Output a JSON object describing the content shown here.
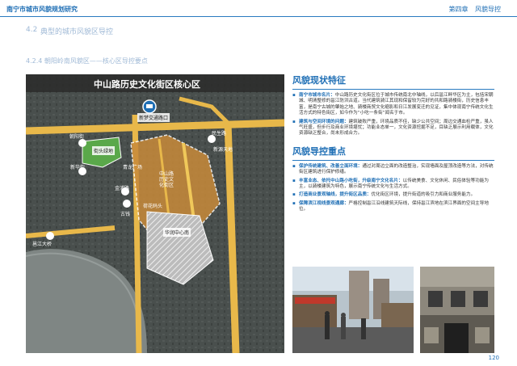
{
  "header": {
    "left": "南宁市城市风貌规划研究",
    "right_chapter": "第四章",
    "right_section": "风貌导控"
  },
  "section": {
    "number": "4.2",
    "title": "典型的城市风貌区导控"
  },
  "subsection": {
    "title": "4.2.4 朝阳岭南风貌区——核心区导控要点"
  },
  "map": {
    "title": "中山路历史文化街区核心区",
    "labels": {
      "traffic_hub": "新梦交通路口",
      "park": "街头绿地",
      "chaoyang_street": "朝阳街",
      "minsheng_road": "民生路",
      "xinhua_street": "新华街",
      "qinglong_square": "青龙广场",
      "zhongshan_road": "中山路历史文化街区",
      "jinpu_road": "金浦路",
      "gujing": "古钱",
      "hehua_ferry": "荷花码头",
      "zhongshan_road_south": "中山路",
      "yongjiang_bridge": "邕江大桥",
      "xinyuan_tiandi": "新源天地",
      "huaxia_plaza": "华润中心南",
      "baiyun_pavilion": "岜蒙江亭"
    }
  },
  "features": {
    "heading": "风貌现状特征",
    "items": [
      {
        "label": "南宁市城市名片：",
        "text": "中山路历史文化街区位于城市传统南北中轴线，以后邕江畔华区为主，包括宋朝城、明清整修的邕江防洪古道。当代建筑骑江其现和保留较为完好的共和路骑楼街，历史信息丰富，是南宁古城的肇始之地、骑楼商贸文化缩影和日江发展变迁的见证，集中体现南宁传统文化生活方式的特色街区，如今作为“小吃一条街”闻名于市。"
      },
      {
        "label": "建筑与空间环境的问题：",
        "text": "建筑破败严重，环境品质不佳，缺少公共空间；周边交通血检严重，虽人气旺盛，但步行及商业环境堪忧；功能业态单一，文化资源挖掘不足，目缺乏展示利用载体，文化资源缺乏整合，尚未形成合力。"
      }
    ]
  },
  "guidance": {
    "heading": "风貌导控重点",
    "items": [
      {
        "label": "保护传统建筑、改善立面环境：",
        "text": "通过对周边立面的改造整治，实现墙面及屋顶改造等方法，对传统街区建筑进行保护修缮。"
      },
      {
        "label": "丰富业态、依托中山路小吃街，升级南宁文化名片：",
        "text": "以传统美食、文化休闲、民俗体验等功能为主，以骑楼建筑为特色，展示南宁传统文化与生活方式。"
      },
      {
        "label": "打造商业景观轴线，提升街区品质：",
        "text": "优化街区环境，提升街道的吸引力和商业服务能力。"
      },
      {
        "label": "保障滨江视线景观通廊：",
        "text": "严格控制邕江沿线建筑天际线，保持邕江滨地在滨江界面的空间主导地位。"
      }
    ]
  },
  "page_number": "120",
  "colors": {
    "accent": "#1f6fb5",
    "road": "#e8b84a",
    "historic": "#c88a3a",
    "green": "#5aa84a"
  }
}
